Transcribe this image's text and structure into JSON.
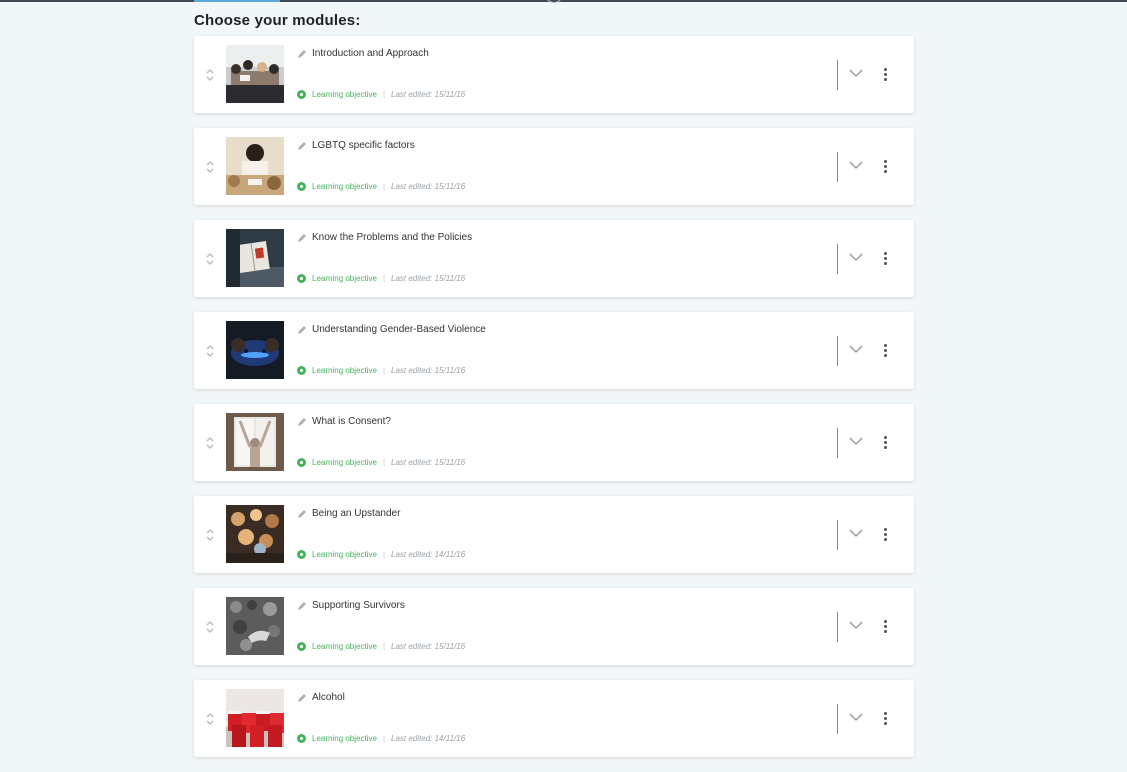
{
  "page": {
    "heading": "Choose your modules:"
  },
  "colors": {
    "accent": "#47b25e",
    "card_bg": "#ffffff",
    "page_bg": "#f1f6f8"
  },
  "modules": [
    {
      "title": "Introduction and Approach",
      "objective_label": "Learning objective",
      "separator": "|",
      "last_edited": "Last edited: 15/11/16",
      "image": "group-meeting-photo"
    },
    {
      "title": "LGBTQ specific factors",
      "objective_label": "Learning objective",
      "separator": "|",
      "last_edited": "Last edited: 15/11/16",
      "image": "table-discussion-photo"
    },
    {
      "title": "Know the Problems and the Policies",
      "objective_label": "Learning objective",
      "separator": "|",
      "last_edited": "Last edited: 15/11/16",
      "image": "open-book-photo"
    },
    {
      "title": "Understanding Gender-Based Violence",
      "objective_label": "Learning objective",
      "separator": "|",
      "last_edited": "Last edited: 15/11/16",
      "image": "game-controller-photo"
    },
    {
      "title": "What is Consent?",
      "objective_label": "Learning objective",
      "separator": "|",
      "last_edited": "Last edited: 15/11/16",
      "image": "window-stretch-photo"
    },
    {
      "title": "Being an Upstander",
      "objective_label": "Learning objective",
      "separator": "|",
      "last_edited": "Last edited: 14/11/16",
      "image": "party-crowd-photo"
    },
    {
      "title": "Supporting Survivors",
      "objective_label": "Learning objective",
      "separator": "|",
      "last_edited": "Last edited: 15/11/16",
      "image": "hand-in-leaves-photo"
    },
    {
      "title": "Alcohol",
      "objective_label": "Learning objective",
      "separator": "|",
      "last_edited": "Last edited: 14/11/16",
      "image": "red-cups-photo"
    }
  ],
  "icons": {
    "drag": "drag-handle-icon",
    "edit": "pencil-icon",
    "status": "learning-objective-icon",
    "expand": "chevron-down-icon",
    "menu": "more-vertical-icon"
  }
}
